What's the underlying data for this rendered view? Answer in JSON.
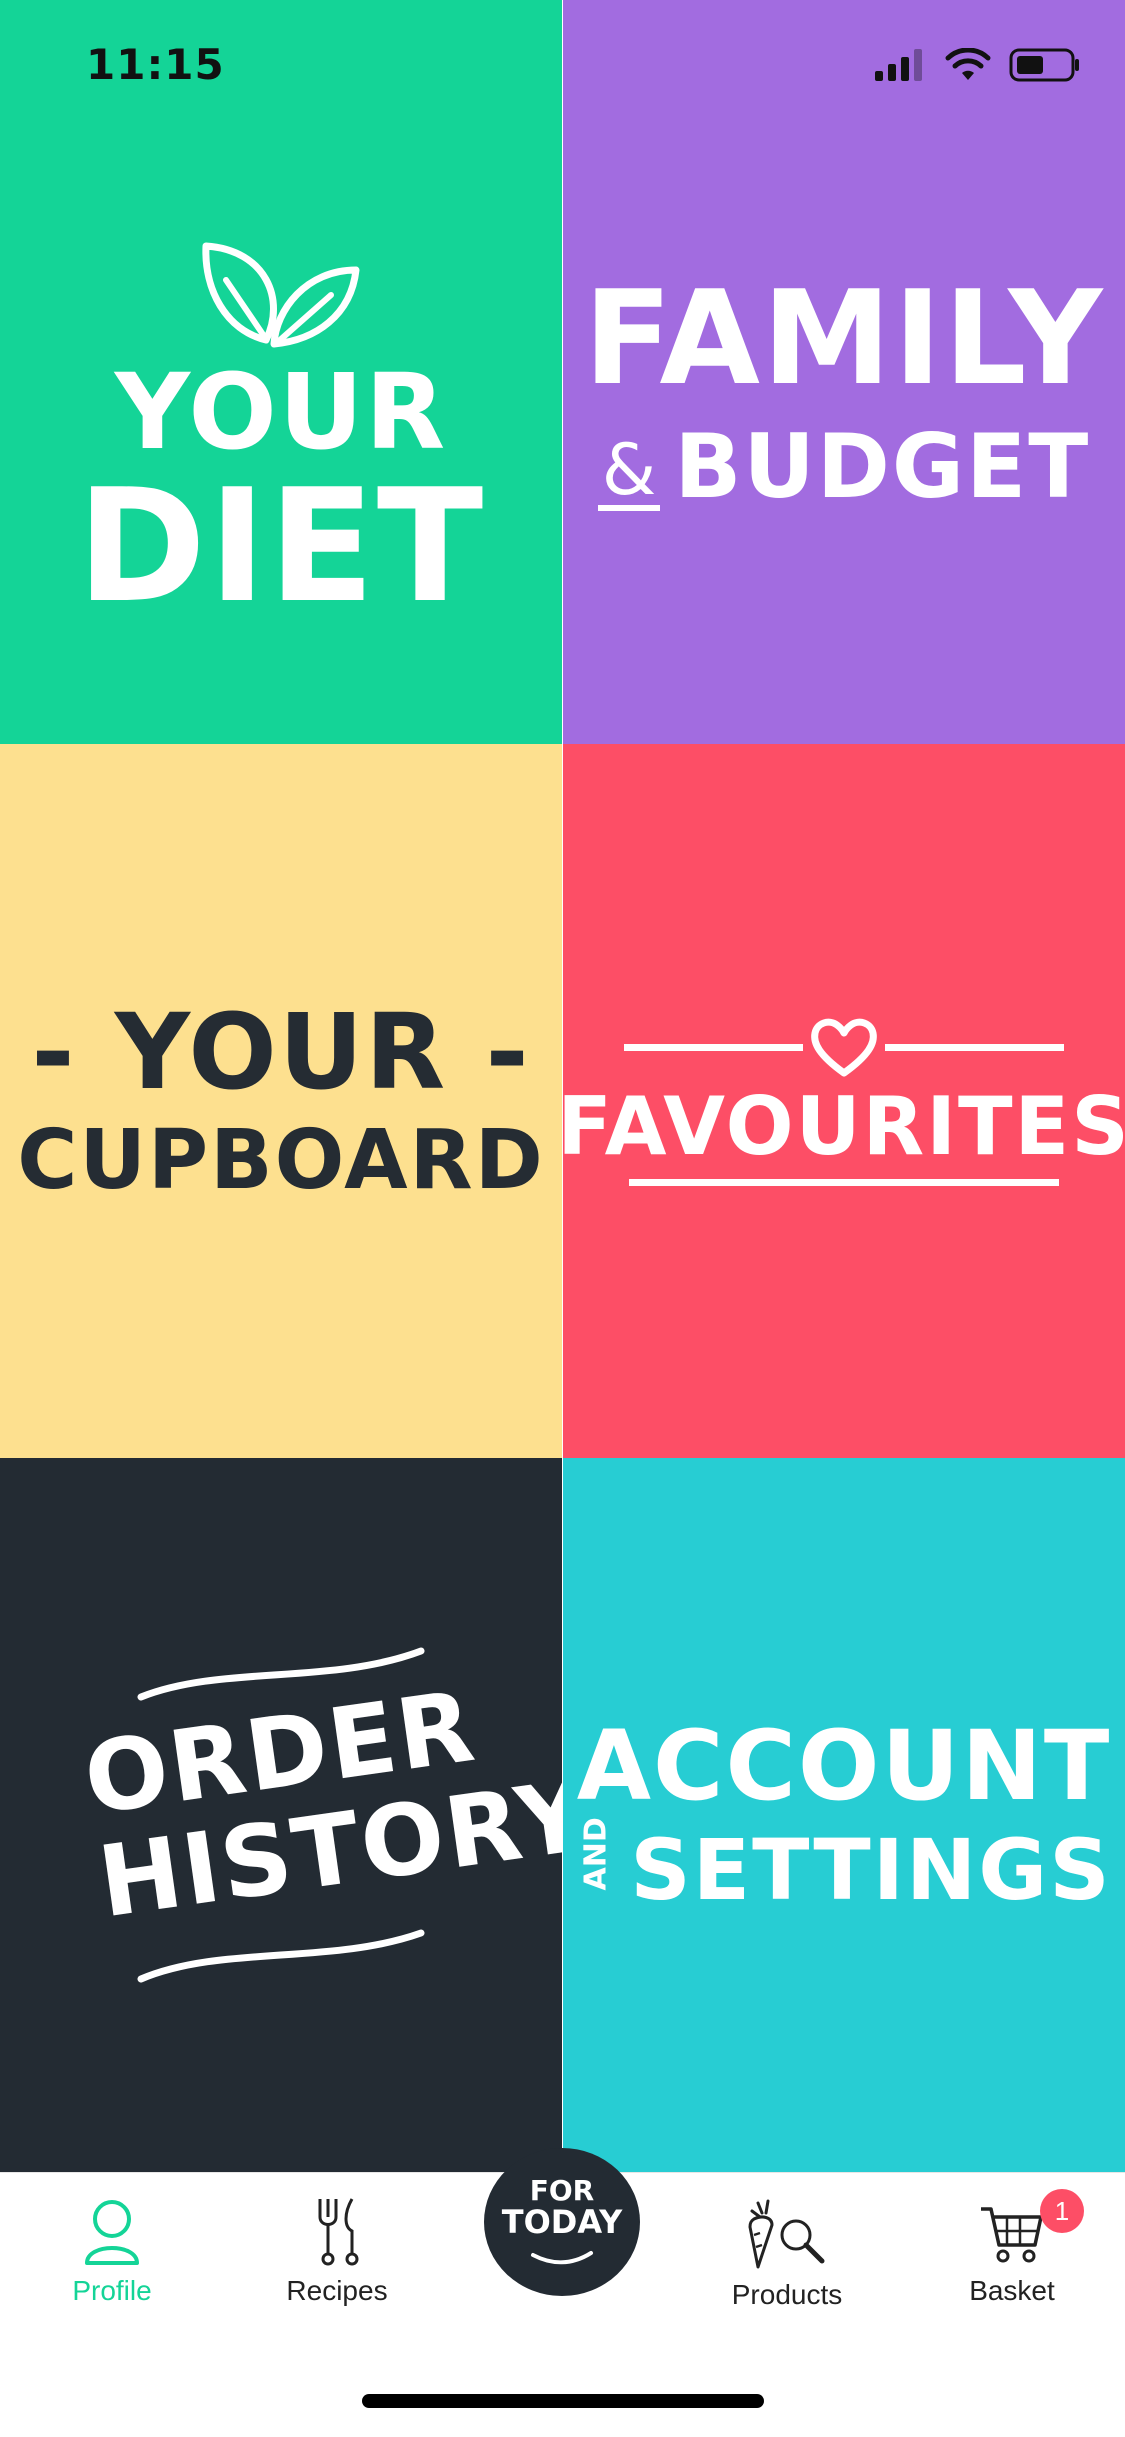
{
  "status_bar": {
    "time": "11:15"
  },
  "tiles": {
    "diet": {
      "line1": "YOUR",
      "line2": "DIET",
      "color": "#14d497"
    },
    "family": {
      "line1": "FAMILY",
      "amp": "&",
      "line2": "BUDGET",
      "color": "#a26ce0"
    },
    "cupboard": {
      "line1": "- YOUR -",
      "line2": "CUPBOARD",
      "color": "#fde08f"
    },
    "favourites": {
      "label": "FAVOURITES",
      "color": "#fd4e66"
    },
    "order": {
      "line1": "ORDER",
      "line2": "HISTORY",
      "color": "#232b33"
    },
    "account": {
      "line1": "ACCOUNT",
      "and": "AND",
      "line2": "SETTINGS",
      "color": "#27cdd3"
    }
  },
  "tabbar": {
    "profile": "Profile",
    "recipes": "Recipes",
    "for_today_line1": "FOR",
    "for_today_line2": "TODAY",
    "products": "Products",
    "basket": "Basket",
    "basket_badge": "1",
    "active_color": "#14d497"
  }
}
